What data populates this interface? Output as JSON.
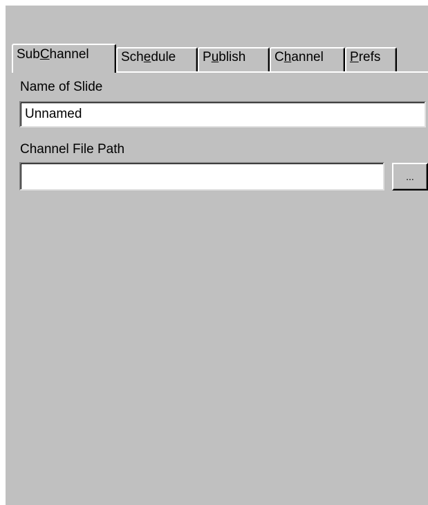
{
  "tabs": [
    {
      "pre": "Sub",
      "key": "C",
      "post": "hannel",
      "active": true
    },
    {
      "pre": "Sch",
      "key": "e",
      "post": "dule",
      "active": false
    },
    {
      "pre": "P",
      "key": "u",
      "post": "blish",
      "active": false
    },
    {
      "pre": "C",
      "key": "h",
      "post": "annel",
      "active": false
    },
    {
      "pre": "",
      "key": "P",
      "post": "refs",
      "active": false
    }
  ],
  "form": {
    "name_label": "Name of Slide",
    "name_value": "Unnamed",
    "path_label": "Channel File Path",
    "path_value": "",
    "browse_label": "..."
  }
}
